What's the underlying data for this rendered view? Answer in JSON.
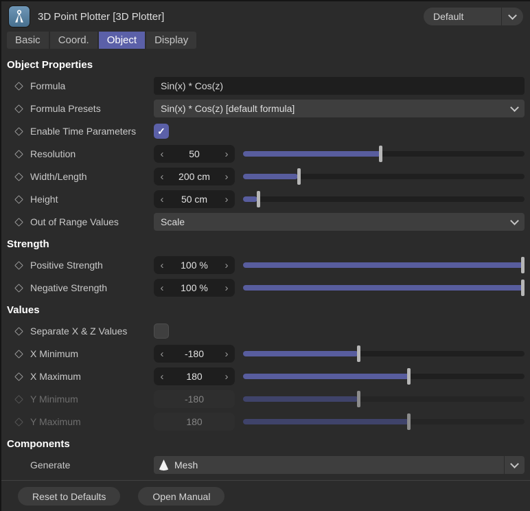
{
  "colors": {
    "accent": "#5b60a8",
    "slider_fill": "#585d9e",
    "background": "#2b2b2b",
    "field_dark": "#1e1e1e",
    "dropdown_bg": "#3e3e3e"
  },
  "titlebar": {
    "title": "3D Point Plotter [3D Plotter]",
    "app_icon": "compass-icon",
    "preset_dropdown": {
      "value": "Default"
    }
  },
  "tabs": [
    {
      "label": "Basic",
      "active": false
    },
    {
      "label": "Coord.",
      "active": false
    },
    {
      "label": "Object",
      "active": true
    },
    {
      "label": "Display",
      "active": false
    }
  ],
  "sections": {
    "object_properties": {
      "title": "Object Properties"
    },
    "strength": {
      "title": "Strength"
    },
    "values": {
      "title": "Values"
    },
    "components": {
      "title": "Components"
    }
  },
  "stepper": {
    "decrement": "‹",
    "increment": "›"
  },
  "rows": {
    "formula": {
      "label": "Formula",
      "value": "Sin(x) * Cos(z)"
    },
    "formula_presets": {
      "label": "Formula Presets",
      "value": "Sin(x) * Cos(z) [default formula]"
    },
    "enable_time_parameters": {
      "label": "Enable Time Parameters",
      "checked": true
    },
    "resolution": {
      "label": "Resolution",
      "value": "50",
      "fraction": 0.49
    },
    "width_length": {
      "label": "Width/Length",
      "value": "200 cm",
      "fraction": 0.195
    },
    "height": {
      "label": "Height",
      "value": "50 cm",
      "fraction": 0.05
    },
    "out_of_range_values": {
      "label": "Out of Range Values",
      "value": "Scale"
    },
    "positive_strength": {
      "label": "Positive Strength",
      "value": "100 %",
      "fraction": 1
    },
    "negative_strength": {
      "label": "Negative Strength",
      "value": "100 %",
      "fraction": 1
    },
    "separate_xz_values": {
      "label": "Separate X & Z Values",
      "checked": false
    },
    "x_minimum": {
      "label": "X Minimum",
      "value": "-180",
      "fraction": 0.41
    },
    "x_maximum": {
      "label": "X Maximum",
      "value": "180",
      "fraction": 0.59
    },
    "y_minimum": {
      "label": "Y Minimum",
      "value": "-180",
      "fraction": 0.41,
      "disabled": true
    },
    "y_maximum": {
      "label": "Y Maximum",
      "value": "180",
      "fraction": 0.59,
      "disabled": true
    },
    "generate": {
      "label": "Generate",
      "value": "Mesh",
      "icon": "mesh-cone-icon"
    }
  },
  "buttons": {
    "reset": "Reset to Defaults",
    "manual": "Open Manual"
  }
}
